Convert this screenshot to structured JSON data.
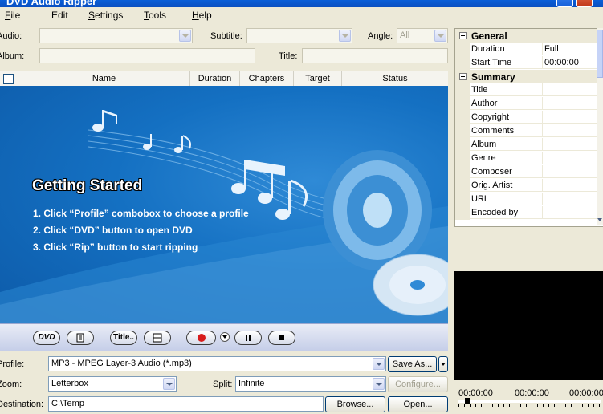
{
  "window": {
    "title": "DVD Audio Ripper"
  },
  "menu": [
    {
      "label": "File",
      "u": "F",
      "rest": "ile"
    },
    {
      "label": "Edit",
      "u": "",
      "rest": "Edit"
    },
    {
      "label": "Settings",
      "u": "S",
      "rest": "ettings"
    },
    {
      "label": "Tools",
      "u": "T",
      "rest": "ools"
    },
    {
      "label": "Help",
      "u": "H",
      "rest": "elp"
    }
  ],
  "options": {
    "audio_label": "Audio:",
    "subtitle_label": "Subtitle:",
    "angle_label": "Angle:",
    "angle_value": "All",
    "album_label": "Album:",
    "title_label": "Title:"
  },
  "list": {
    "columns": [
      "Name",
      "Duration",
      "Chapters",
      "Target",
      "Status"
    ]
  },
  "getting_started": {
    "title": "Getting Started",
    "steps": [
      "1. Click “Profile” combobox to choose a profile",
      "2. Click “DVD” button to open DVD",
      "3. Click “Rip” button to start ripping"
    ]
  },
  "toolbar": {
    "dvd_label": "DVD",
    "title_label": "Title.."
  },
  "settings": {
    "profile_label": "Profile:",
    "profile_value": "MP3 - MPEG Layer-3 Audio  (*.mp3)",
    "save_as_label": "Save As...",
    "zoom_label": "Zoom:",
    "zoom_value": "Letterbox",
    "split_label": "Split:",
    "split_value": "Infinite",
    "configure_label": "Configure...",
    "destination_label": "Destination:",
    "destination_value": "C:\\Temp",
    "browse_label": "Browse...",
    "open_label": "Open..."
  },
  "properties": {
    "general": {
      "name": "General",
      "rows": [
        {
          "key": "Duration",
          "value": "Full"
        },
        {
          "key": "Start Time",
          "value": "00:00:00"
        }
      ]
    },
    "summary": {
      "name": "Summary",
      "rows": [
        {
          "key": "Title",
          "value": ""
        },
        {
          "key": "Author",
          "value": ""
        },
        {
          "key": "Copyright",
          "value": ""
        },
        {
          "key": "Comments",
          "value": ""
        },
        {
          "key": "Album",
          "value": ""
        },
        {
          "key": "Genre",
          "value": ""
        },
        {
          "key": "Composer",
          "value": ""
        },
        {
          "key": "Orig. Artist",
          "value": ""
        },
        {
          "key": "URL",
          "value": ""
        },
        {
          "key": "Encoded by",
          "value": ""
        }
      ]
    }
  },
  "player": {
    "time_start": "00:00:00",
    "time_current": "00:00:00",
    "time_end": "00:00:00"
  },
  "colors": {
    "banner": "#1470c2",
    "titlebar": "#0a5fd8",
    "record": "#d81c1c"
  }
}
